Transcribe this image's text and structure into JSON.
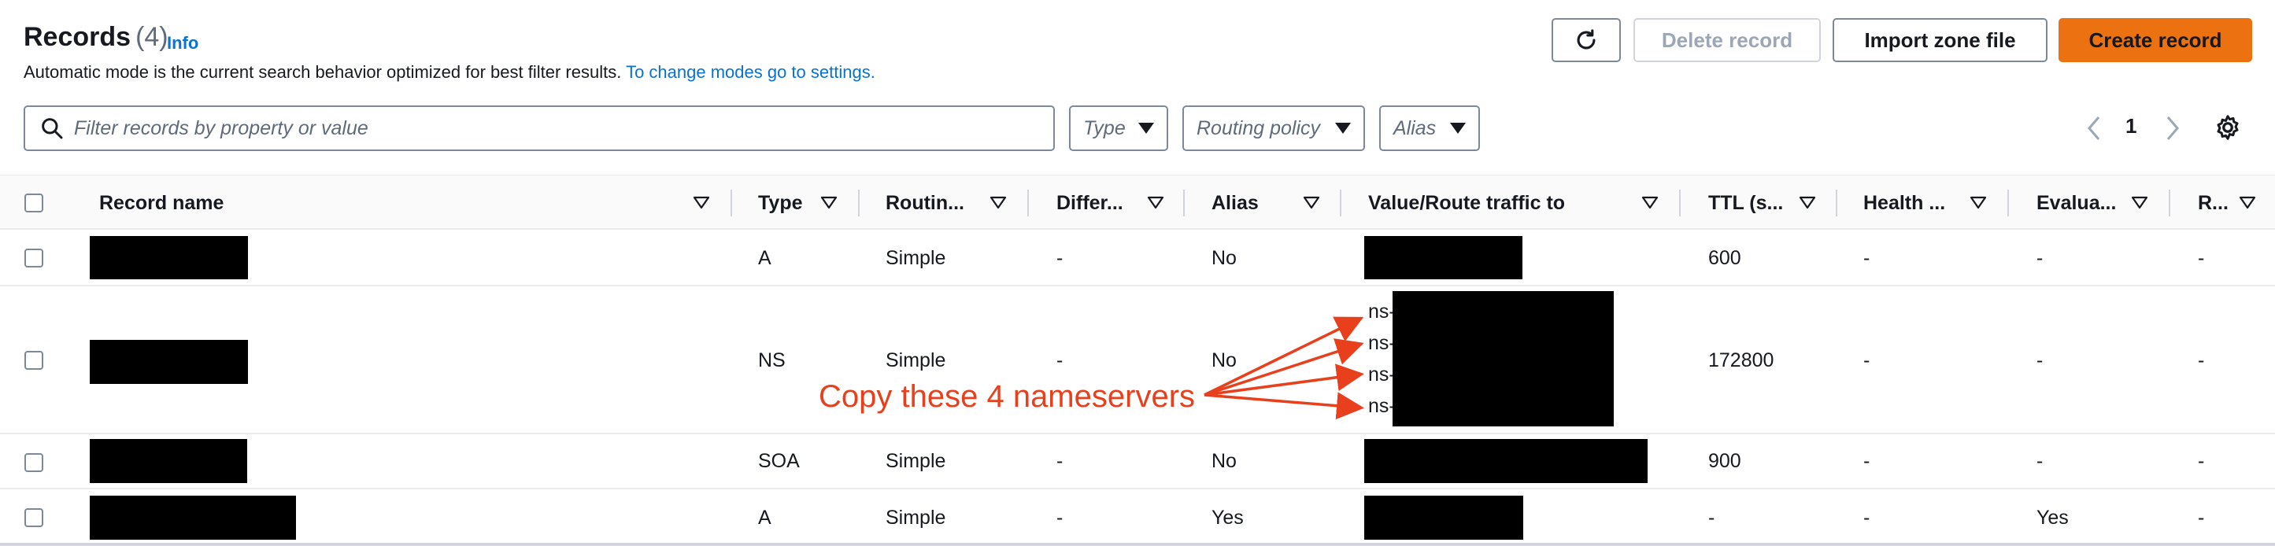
{
  "header": {
    "title": "Records",
    "count": "(4)",
    "info_link": "Info",
    "subtitle_text": "Automatic mode is the current search behavior optimized for best filter results.",
    "subtitle_link": "To change modes go to settings."
  },
  "toolbar": {
    "delete_label": "Delete record",
    "import_label": "Import zone file",
    "create_label": "Create record"
  },
  "filters": {
    "search_placeholder": "Filter records by property or value",
    "type_label": "Type",
    "routing_label": "Routing policy",
    "alias_label": "Alias"
  },
  "pagination": {
    "current_page": "1"
  },
  "table": {
    "columns": [
      "Record name",
      "Type",
      "Routin...",
      "Differ...",
      "Alias",
      "Value/Route traffic to",
      "TTL (s...",
      "Health ...",
      "Evalua...",
      "R..."
    ],
    "rows": [
      {
        "type": "A",
        "routing": "Simple",
        "differ": "-",
        "alias": "No",
        "ttl": "600",
        "health": "-",
        "evaluate": "-",
        "r": "-"
      },
      {
        "type": "NS",
        "routing": "Simple",
        "differ": "-",
        "alias": "No",
        "ttl": "172800",
        "health": "-",
        "evaluate": "-",
        "r": "-",
        "values": [
          "ns-",
          "ns-",
          "ns-",
          "ns-"
        ]
      },
      {
        "type": "SOA",
        "routing": "Simple",
        "differ": "-",
        "alias": "No",
        "ttl": "900",
        "health": "-",
        "evaluate": "-",
        "r": "-"
      },
      {
        "type": "A",
        "routing": "Simple",
        "differ": "-",
        "alias": "Yes",
        "ttl": "-",
        "health": "-",
        "evaluate": "Yes",
        "r": "-"
      }
    ]
  },
  "annotation": {
    "text": "Copy these 4 nameservers",
    "color": "#e8401c"
  },
  "colors": {
    "primary_button": "#ec7211",
    "link": "#0972d3",
    "redaction": "#000000"
  },
  "icons": [
    "refresh-icon",
    "search-icon",
    "chevron-left-icon",
    "chevron-right-icon",
    "gear-icon",
    "sort-caret-icon",
    "dropdown-caret-icon"
  ]
}
